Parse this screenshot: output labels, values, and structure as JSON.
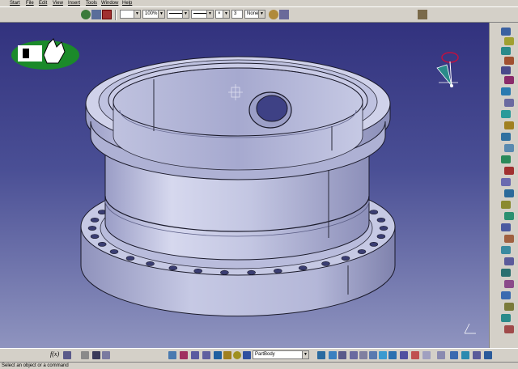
{
  "menu": {
    "items": [
      "Start",
      "File",
      "Edit",
      "View",
      "Insert",
      "Tools",
      "Window",
      "Help"
    ]
  },
  "toolbar": {
    "color_value": "",
    "zoom_value": "100%",
    "linetype_value": "",
    "lineweight_value": "",
    "layer_value": "3",
    "none_value": "None"
  },
  "bottom_toolbar": {
    "body_value": "PartBody",
    "fx_label": "f(x)"
  },
  "status": {
    "message": "Select an object or a command"
  },
  "colors": {
    "viewport_top": "#32327e",
    "viewport_bottom": "#8f94bf",
    "part_fill": "#c9cce6",
    "part_shadow": "#8c8fb5",
    "toolbar_bg": "#d4d0c8"
  },
  "icons": {
    "logo": "catia-logo-icon",
    "compass": "compass-icon",
    "axis": "axis-system-icon"
  }
}
